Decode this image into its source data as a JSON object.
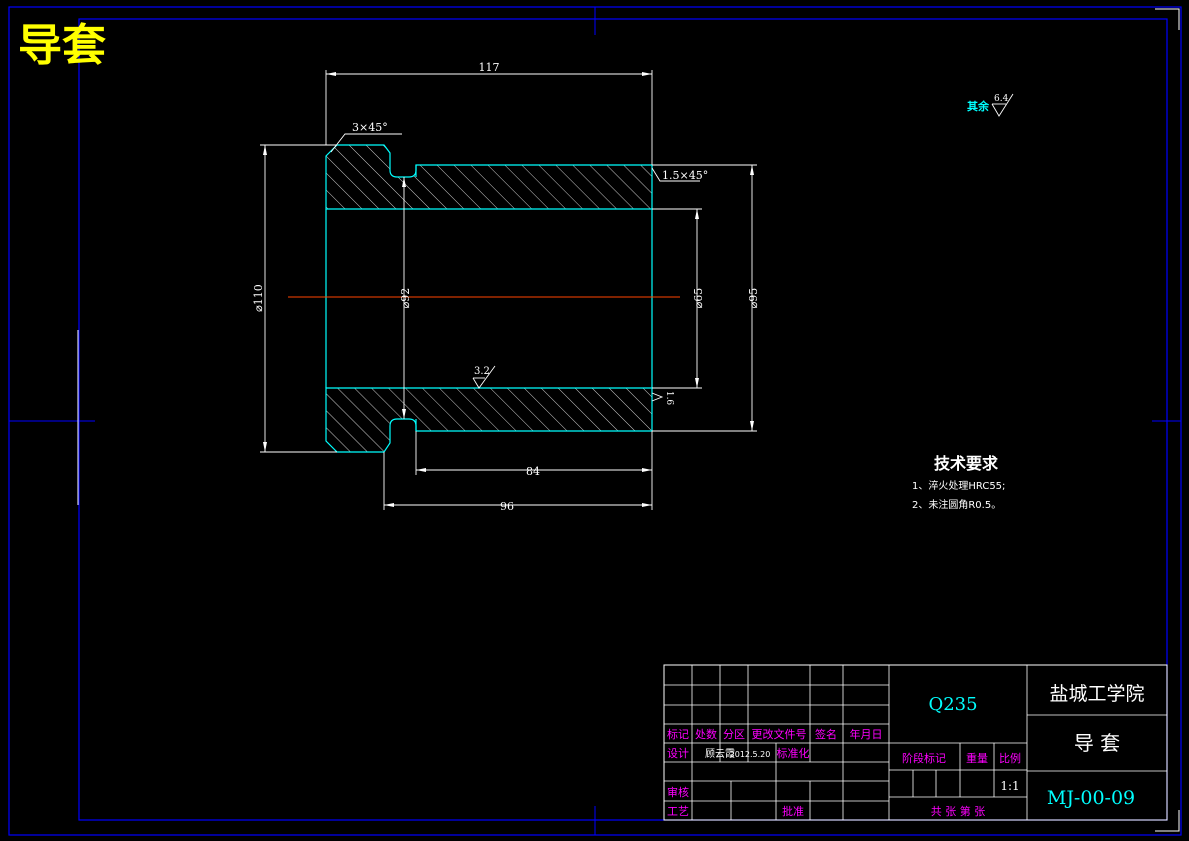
{
  "page_title": "导套",
  "colors": {
    "frame": "#0000ff",
    "outline": "#00ffff",
    "dim": "#ffffff",
    "center": "#ff4500",
    "title": "#ffff00",
    "magenta": "#ff00ff"
  },
  "drawing": {
    "dims": {
      "overall_length": "117",
      "chamfer_left": "3×45°",
      "chamfer_right": "1.5×45°",
      "outer_dia": "⌀110",
      "groove_dia": "⌀92",
      "inner_dia": "⌀65",
      "shaft_dia": "⌀95",
      "len_84": "84",
      "len_96": "96",
      "roughness_bore": "3.2",
      "roughness_face": "1.6",
      "roughness_rest_label": "其余",
      "roughness_rest_value": "6.4"
    },
    "tech_req": {
      "title": "技术要求",
      "items": [
        "1、淬火处理HRC55;",
        "2、未注圆角R0.5。"
      ]
    }
  },
  "title_block": {
    "material": "Q235",
    "school": "盐城工学院",
    "part_name": "导 套",
    "drawing_no": "MJ-00-09",
    "scale": "1:1",
    "headers": [
      "标记",
      "处数",
      "分区",
      "更改文件号",
      "签名",
      "年月日"
    ],
    "design_label": "设计",
    "designer": "顾云霞",
    "design_date": "2012.5.20",
    "std_label": "标准化",
    "check_label": "审核",
    "process_label": "工艺",
    "approve_label": "批准",
    "stage_label": "阶段标记",
    "weight_label": "重量",
    "ratio_label": "比例",
    "sheets_label": "共  张 第  张"
  }
}
